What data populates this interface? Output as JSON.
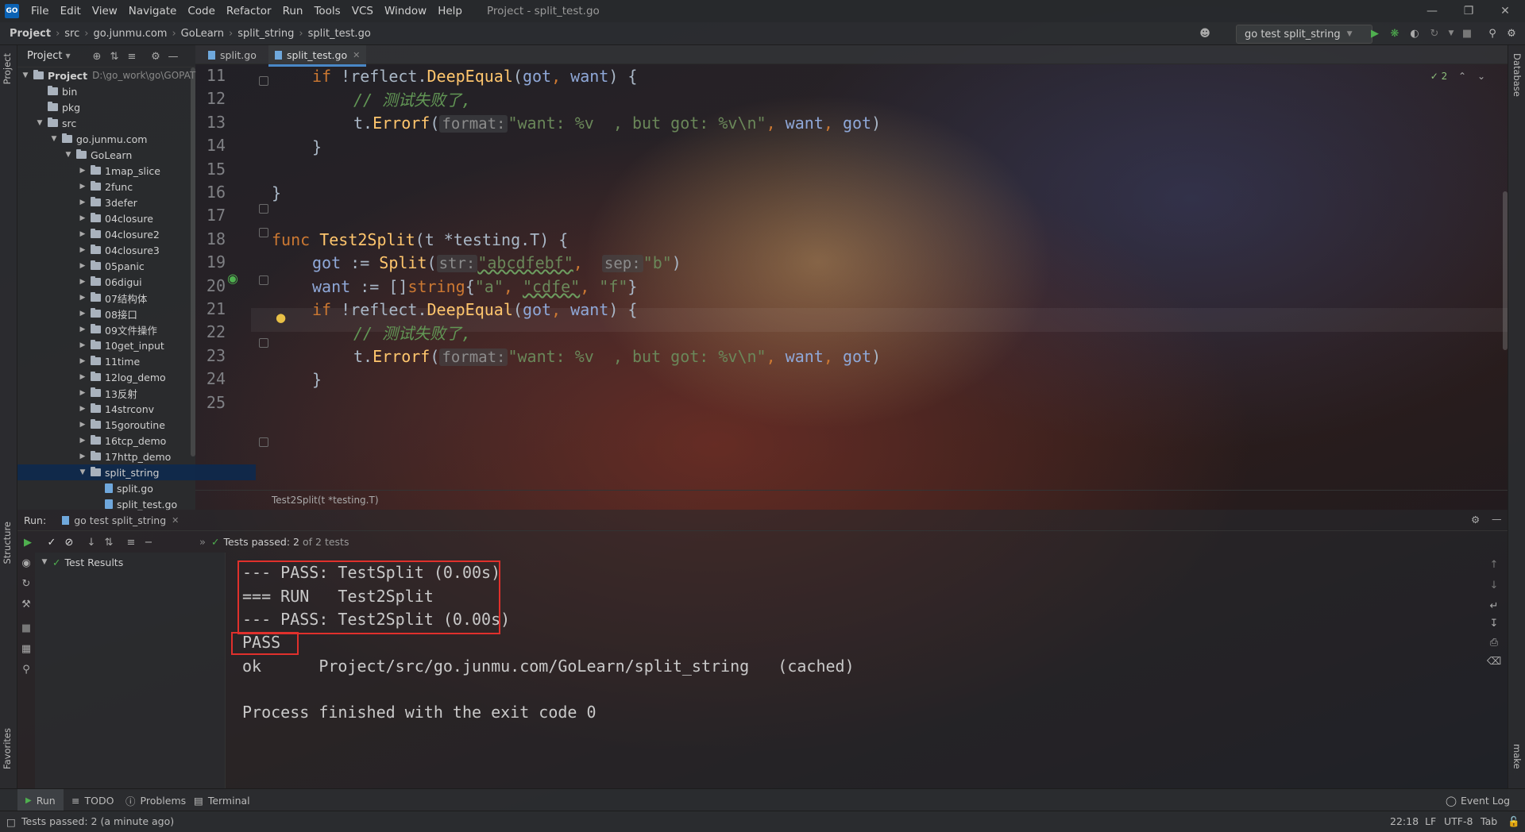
{
  "menu": {
    "logo": "GO",
    "items": [
      "File",
      "Edit",
      "View",
      "Navigate",
      "Code",
      "Refactor",
      "Run",
      "Tools",
      "VCS",
      "Window",
      "Help"
    ],
    "window_title": "Project - split_test.go"
  },
  "navbar": {
    "crumbs": [
      "Project",
      "src",
      "go.junmu.com",
      "GoLearn",
      "split_string",
      "split_test.go"
    ],
    "run_config": "go test split_string"
  },
  "left_strip": {
    "project_label": "Project",
    "structure_label": "Structure",
    "favorites_label": "Favorites"
  },
  "right_strip": {
    "database_label": "Database",
    "make_label": "make"
  },
  "project_panel": {
    "title": "Project",
    "root_label": "Project",
    "root_path": "D:\\go_work\\go\\GOPAT",
    "items": [
      {
        "label": "bin",
        "level": 1,
        "type": "folder",
        "expanded": null
      },
      {
        "label": "pkg",
        "level": 1,
        "type": "folder",
        "expanded": null
      },
      {
        "label": "src",
        "level": 1,
        "type": "folder",
        "expanded": true
      },
      {
        "label": "go.junmu.com",
        "level": 2,
        "type": "folder",
        "expanded": true
      },
      {
        "label": "GoLearn",
        "level": 3,
        "type": "folder",
        "expanded": true
      },
      {
        "label": "1map_slice",
        "level": 4,
        "type": "folder",
        "expanded": false
      },
      {
        "label": "2func",
        "level": 4,
        "type": "folder",
        "expanded": false
      },
      {
        "label": "3defer",
        "level": 4,
        "type": "folder",
        "expanded": false
      },
      {
        "label": "04closure",
        "level": 4,
        "type": "folder",
        "expanded": false
      },
      {
        "label": "04closure2",
        "level": 4,
        "type": "folder",
        "expanded": false
      },
      {
        "label": "04closure3",
        "level": 4,
        "type": "folder",
        "expanded": false
      },
      {
        "label": "05panic",
        "level": 4,
        "type": "folder",
        "expanded": false
      },
      {
        "label": "06digui",
        "level": 4,
        "type": "folder",
        "expanded": false
      },
      {
        "label": "07结构体",
        "level": 4,
        "type": "folder",
        "expanded": false
      },
      {
        "label": "08接口",
        "level": 4,
        "type": "folder",
        "expanded": false
      },
      {
        "label": "09文件操作",
        "level": 4,
        "type": "folder",
        "expanded": false
      },
      {
        "label": "10get_input",
        "level": 4,
        "type": "folder",
        "expanded": false
      },
      {
        "label": "11time",
        "level": 4,
        "type": "folder",
        "expanded": false
      },
      {
        "label": "12log_demo",
        "level": 4,
        "type": "folder",
        "expanded": false
      },
      {
        "label": "13反射",
        "level": 4,
        "type": "folder",
        "expanded": false
      },
      {
        "label": "14strconv",
        "level": 4,
        "type": "folder",
        "expanded": false
      },
      {
        "label": "15goroutine",
        "level": 4,
        "type": "folder",
        "expanded": false
      },
      {
        "label": "16tcp_demo",
        "level": 4,
        "type": "folder",
        "expanded": false
      },
      {
        "label": "17http_demo",
        "level": 4,
        "type": "folder",
        "expanded": false
      },
      {
        "label": "split_string",
        "level": 4,
        "type": "folder",
        "expanded": true,
        "selected": true
      },
      {
        "label": "split.go",
        "level": 5,
        "type": "file",
        "expanded": null
      },
      {
        "label": "split_test.go",
        "level": 5,
        "type": "file",
        "expanded": null
      }
    ]
  },
  "editor": {
    "tabs": [
      {
        "label": "split.go",
        "active": false
      },
      {
        "label": "split_test.go",
        "active": true
      }
    ],
    "inspection_count": "2",
    "line_numbers": [
      "11",
      "12",
      "13",
      "14",
      "15",
      "16",
      "17",
      "18",
      "19",
      "20",
      "21",
      "22",
      "23",
      "24",
      "25"
    ],
    "code": {
      "l11": {
        "kw": "if",
        "pre": " !",
        "pkg": "reflect.",
        "fn": "DeepEqual",
        "open": "(",
        "a": "got",
        ", ": ", ",
        "b": "want",
        "close": ") {"
      },
      "l12": "// 测试失败了,",
      "l13": {
        "obj": "t.",
        "fn": "Errorf",
        "open": "(",
        "hint": "format:",
        "str1": "\"want: %v  , but got: %v\\n\"",
        ", ": ", ",
        "a": "want",
        ", 2": ", ",
        "b": "got",
        "close": ")"
      },
      "l14": "}",
      "l16": "}",
      "l18": {
        "kw": "func",
        "name": "Test2Split",
        "open": "(",
        "param": "t",
        "star": " *",
        "type": "testing.T",
        "close": ") {"
      },
      "l19": {
        "var": "got",
        "op": " := ",
        "fn": "Split",
        "open": "(",
        "hint1": "str:",
        "s1": "\"abcdfebf\"",
        ", ": ", ",
        "hint2": "sep:",
        "s2": "\"b\"",
        "close": ")"
      },
      "l20": {
        "var": "want",
        "op": " := ",
        "br": "[]",
        "kw": "string",
        "open": "{",
        "s1": "\"a\"",
        ", ": ", ",
        "s2": "\"cdfe\"",
        ", 2": ", ",
        "s3": "\"f\"",
        "close": "}"
      },
      "l21": {
        "kw": "if",
        "pre": " !",
        "pkg": "reflect.",
        "fn": "DeepEqual",
        "open": "(",
        "a": "got",
        ", ": ", ",
        "b": "want",
        "close": ") {"
      },
      "l22": "// 测试失败了,",
      "l23": {
        "obj": "t.",
        "fn": "Errorf",
        "open": "(",
        "hint": "format:",
        "str1": "\"want: %v  , but got: %v\\n\"",
        ", ": ", ",
        "a": "want",
        ", 2": ", ",
        "b": "got",
        "close": ")"
      },
      "l24": "}"
    },
    "bottom_breadcrumb": "Test2Split(t *testing.T)"
  },
  "run_panel": {
    "label": "Run:",
    "tab_label": "go test split_string",
    "status_prefix": "Tests passed:",
    "status_count": "2",
    "status_suffix": "of 2 tests",
    "test_results_label": "Test Results",
    "console": [
      "--- PASS: TestSplit (0.00s)",
      "=== RUN   Test2Split",
      "--- PASS: Test2Split (0.00s)",
      "PASS",
      "ok      Project/src/go.junmu.com/GoLearn/split_string   (cached)",
      "",
      "Process finished with the exit code 0"
    ]
  },
  "bottom_tabs": {
    "run": "Run",
    "todo": "TODO",
    "problems": "Problems",
    "terminal": "Terminal",
    "event_log": "Event Log"
  },
  "statusbar": {
    "message": "Tests passed: 2 (a minute ago)",
    "position": "22:18",
    "line_sep": "LF",
    "encoding": "UTF-8",
    "indent": "Tab"
  }
}
